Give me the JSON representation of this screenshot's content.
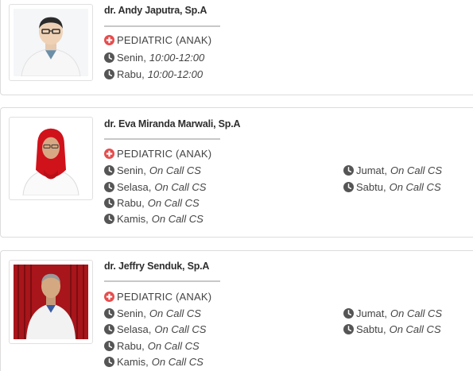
{
  "doctors": [
    {
      "name": "dr. Andy Japutra, Sp.A",
      "specialty": "PEDIATRIC (ANAK)",
      "schedule": [
        {
          "day": "Senin,",
          "time": "10:00-12:00"
        },
        {
          "day": "Rabu,",
          "time": "10:00-12:00"
        }
      ]
    },
    {
      "name": "dr. Eva Miranda Marwali, Sp.A",
      "specialty": "PEDIATRIC (ANAK)",
      "schedule": [
        {
          "day": "Senin,",
          "time": "On Call CS"
        },
        {
          "day": "Selasa,",
          "time": "On Call CS"
        },
        {
          "day": "Rabu,",
          "time": "On Call CS"
        },
        {
          "day": "Kamis,",
          "time": "On Call CS"
        },
        {
          "day": "Jumat,",
          "time": "On Call CS"
        },
        {
          "day": "Sabtu,",
          "time": "On Call CS"
        }
      ]
    },
    {
      "name": "dr. Jeffry Senduk, Sp.A",
      "specialty": "PEDIATRIC (ANAK)",
      "schedule": [
        {
          "day": "Senin,",
          "time": "On Call CS"
        },
        {
          "day": "Selasa,",
          "time": "On Call CS"
        },
        {
          "day": "Rabu,",
          "time": "On Call CS"
        },
        {
          "day": "Kamis,",
          "time": "On Call CS"
        },
        {
          "day": "Jumat,",
          "time": "On Call CS"
        },
        {
          "day": "Sabtu,",
          "time": "On Call CS"
        }
      ]
    }
  ],
  "icons": {
    "specialty": "plus-circle-icon",
    "schedule": "clock-icon"
  },
  "colors": {
    "specialty_icon": "#e74c4c",
    "clock_icon": "#555555",
    "card_border": "#dcdcdc"
  }
}
